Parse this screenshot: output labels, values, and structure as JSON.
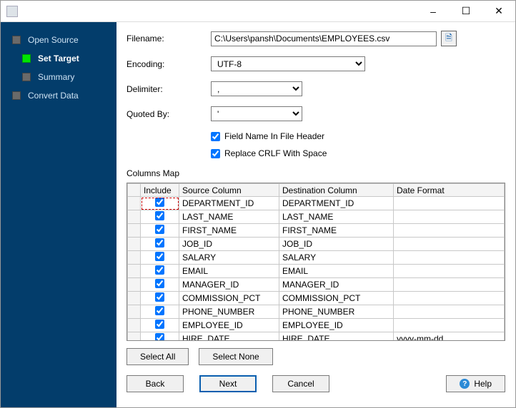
{
  "window": {
    "minimize": "–",
    "maximize": "☐",
    "close": "✕"
  },
  "sidebar": {
    "items": [
      {
        "label": "Open Source",
        "active": false,
        "indent": 0
      },
      {
        "label": "Set Target",
        "active": true,
        "indent": 1,
        "bold": true
      },
      {
        "label": "Summary",
        "active": false,
        "indent": 1
      },
      {
        "label": "Convert Data",
        "active": false,
        "indent": 0
      }
    ]
  },
  "form": {
    "filename_label": "Filename:",
    "filename_value": "C:\\Users\\pansh\\Documents\\EMPLOYEES.csv",
    "encoding_label": "Encoding:",
    "encoding_value": "UTF-8",
    "delimiter_label": "Delimiter:",
    "delimiter_value": ",",
    "quoted_label": "Quoted By:",
    "quoted_value": "'",
    "field_header_label": "Field Name In File Header",
    "field_header_checked": true,
    "replace_crlf_label": "Replace CRLF With Space",
    "replace_crlf_checked": true
  },
  "columns_map_label": "Columns Map",
  "table": {
    "headers": {
      "include": "Include",
      "source": "Source Column",
      "destination": "Destination Column",
      "date_format": "Date Format"
    },
    "rows": [
      {
        "include": true,
        "source": "DEPARTMENT_ID",
        "destination": "DEPARTMENT_ID",
        "date_format": ""
      },
      {
        "include": true,
        "source": "LAST_NAME",
        "destination": "LAST_NAME",
        "date_format": ""
      },
      {
        "include": true,
        "source": "FIRST_NAME",
        "destination": "FIRST_NAME",
        "date_format": ""
      },
      {
        "include": true,
        "source": "JOB_ID",
        "destination": "JOB_ID",
        "date_format": ""
      },
      {
        "include": true,
        "source": "SALARY",
        "destination": "SALARY",
        "date_format": ""
      },
      {
        "include": true,
        "source": "EMAIL",
        "destination": "EMAIL",
        "date_format": ""
      },
      {
        "include": true,
        "source": "MANAGER_ID",
        "destination": "MANAGER_ID",
        "date_format": ""
      },
      {
        "include": true,
        "source": "COMMISSION_PCT",
        "destination": "COMMISSION_PCT",
        "date_format": ""
      },
      {
        "include": true,
        "source": "PHONE_NUMBER",
        "destination": "PHONE_NUMBER",
        "date_format": ""
      },
      {
        "include": true,
        "source": "EMPLOYEE_ID",
        "destination": "EMPLOYEE_ID",
        "date_format": ""
      },
      {
        "include": true,
        "source": "HIRE_DATE",
        "destination": "HIRE_DATE",
        "date_format": "yyyy-mm-dd"
      }
    ]
  },
  "buttons": {
    "select_all": "Select All",
    "select_none": "Select None",
    "back": "Back",
    "next": "Next",
    "cancel": "Cancel",
    "help": "Help"
  }
}
